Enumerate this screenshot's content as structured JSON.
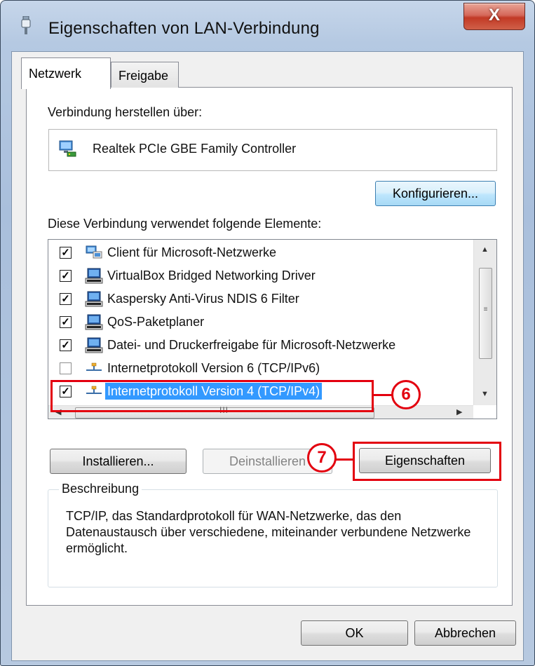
{
  "window": {
    "title": "Eigenschaften von LAN-Verbindung",
    "close_glyph": "X"
  },
  "tabs": [
    {
      "label": "Netzwerk",
      "active": true
    },
    {
      "label": "Freigabe",
      "active": false
    }
  ],
  "connection": {
    "label": "Verbindung herstellen über:",
    "adapter": "Realtek PCIe GBE Family Controller",
    "configure_button": "Konfigurieren..."
  },
  "elements": {
    "label": "Diese Verbindung verwendet folgende Elemente:",
    "items": [
      {
        "label": "Client für Microsoft-Netzwerke",
        "checked": true,
        "icon": "network-client-icon"
      },
      {
        "label": "VirtualBox Bridged Networking Driver",
        "checked": true,
        "icon": "network-service-icon"
      },
      {
        "label": "Kaspersky Anti-Virus NDIS 6 Filter",
        "checked": true,
        "icon": "network-service-icon"
      },
      {
        "label": "QoS-Paketplaner",
        "checked": true,
        "icon": "network-service-icon"
      },
      {
        "label": "Datei- und Druckerfreigabe für Microsoft-Netzwerke",
        "checked": true,
        "icon": "network-service-icon"
      },
      {
        "label": "Internetprotokoll Version 6 (TCP/IPv6)",
        "checked": false,
        "icon": "protocol-icon"
      },
      {
        "label": "Internetprotokoll Version 4 (TCP/IPv4)",
        "checked": true,
        "icon": "protocol-icon",
        "selected": true
      }
    ],
    "scroll_grip": "III",
    "vscroll_grip": "≡"
  },
  "buttons": {
    "install": "Installieren...",
    "uninstall": "Deinstallieren",
    "properties": "Eigenschaften",
    "ok": "OK",
    "cancel": "Abbrechen"
  },
  "description": {
    "legend": "Beschreibung",
    "text": "TCP/IP, das Standardprotokoll für WAN-Netzwerke, das den Datenaustausch über verschiedene, miteinander verbundene Netzwerke ermöglicht."
  },
  "annotations": {
    "step6": "6",
    "step7": "7",
    "color": "#e3000f"
  },
  "colors": {
    "selection": "#3399ff",
    "accent_button": "#bee6fd"
  }
}
